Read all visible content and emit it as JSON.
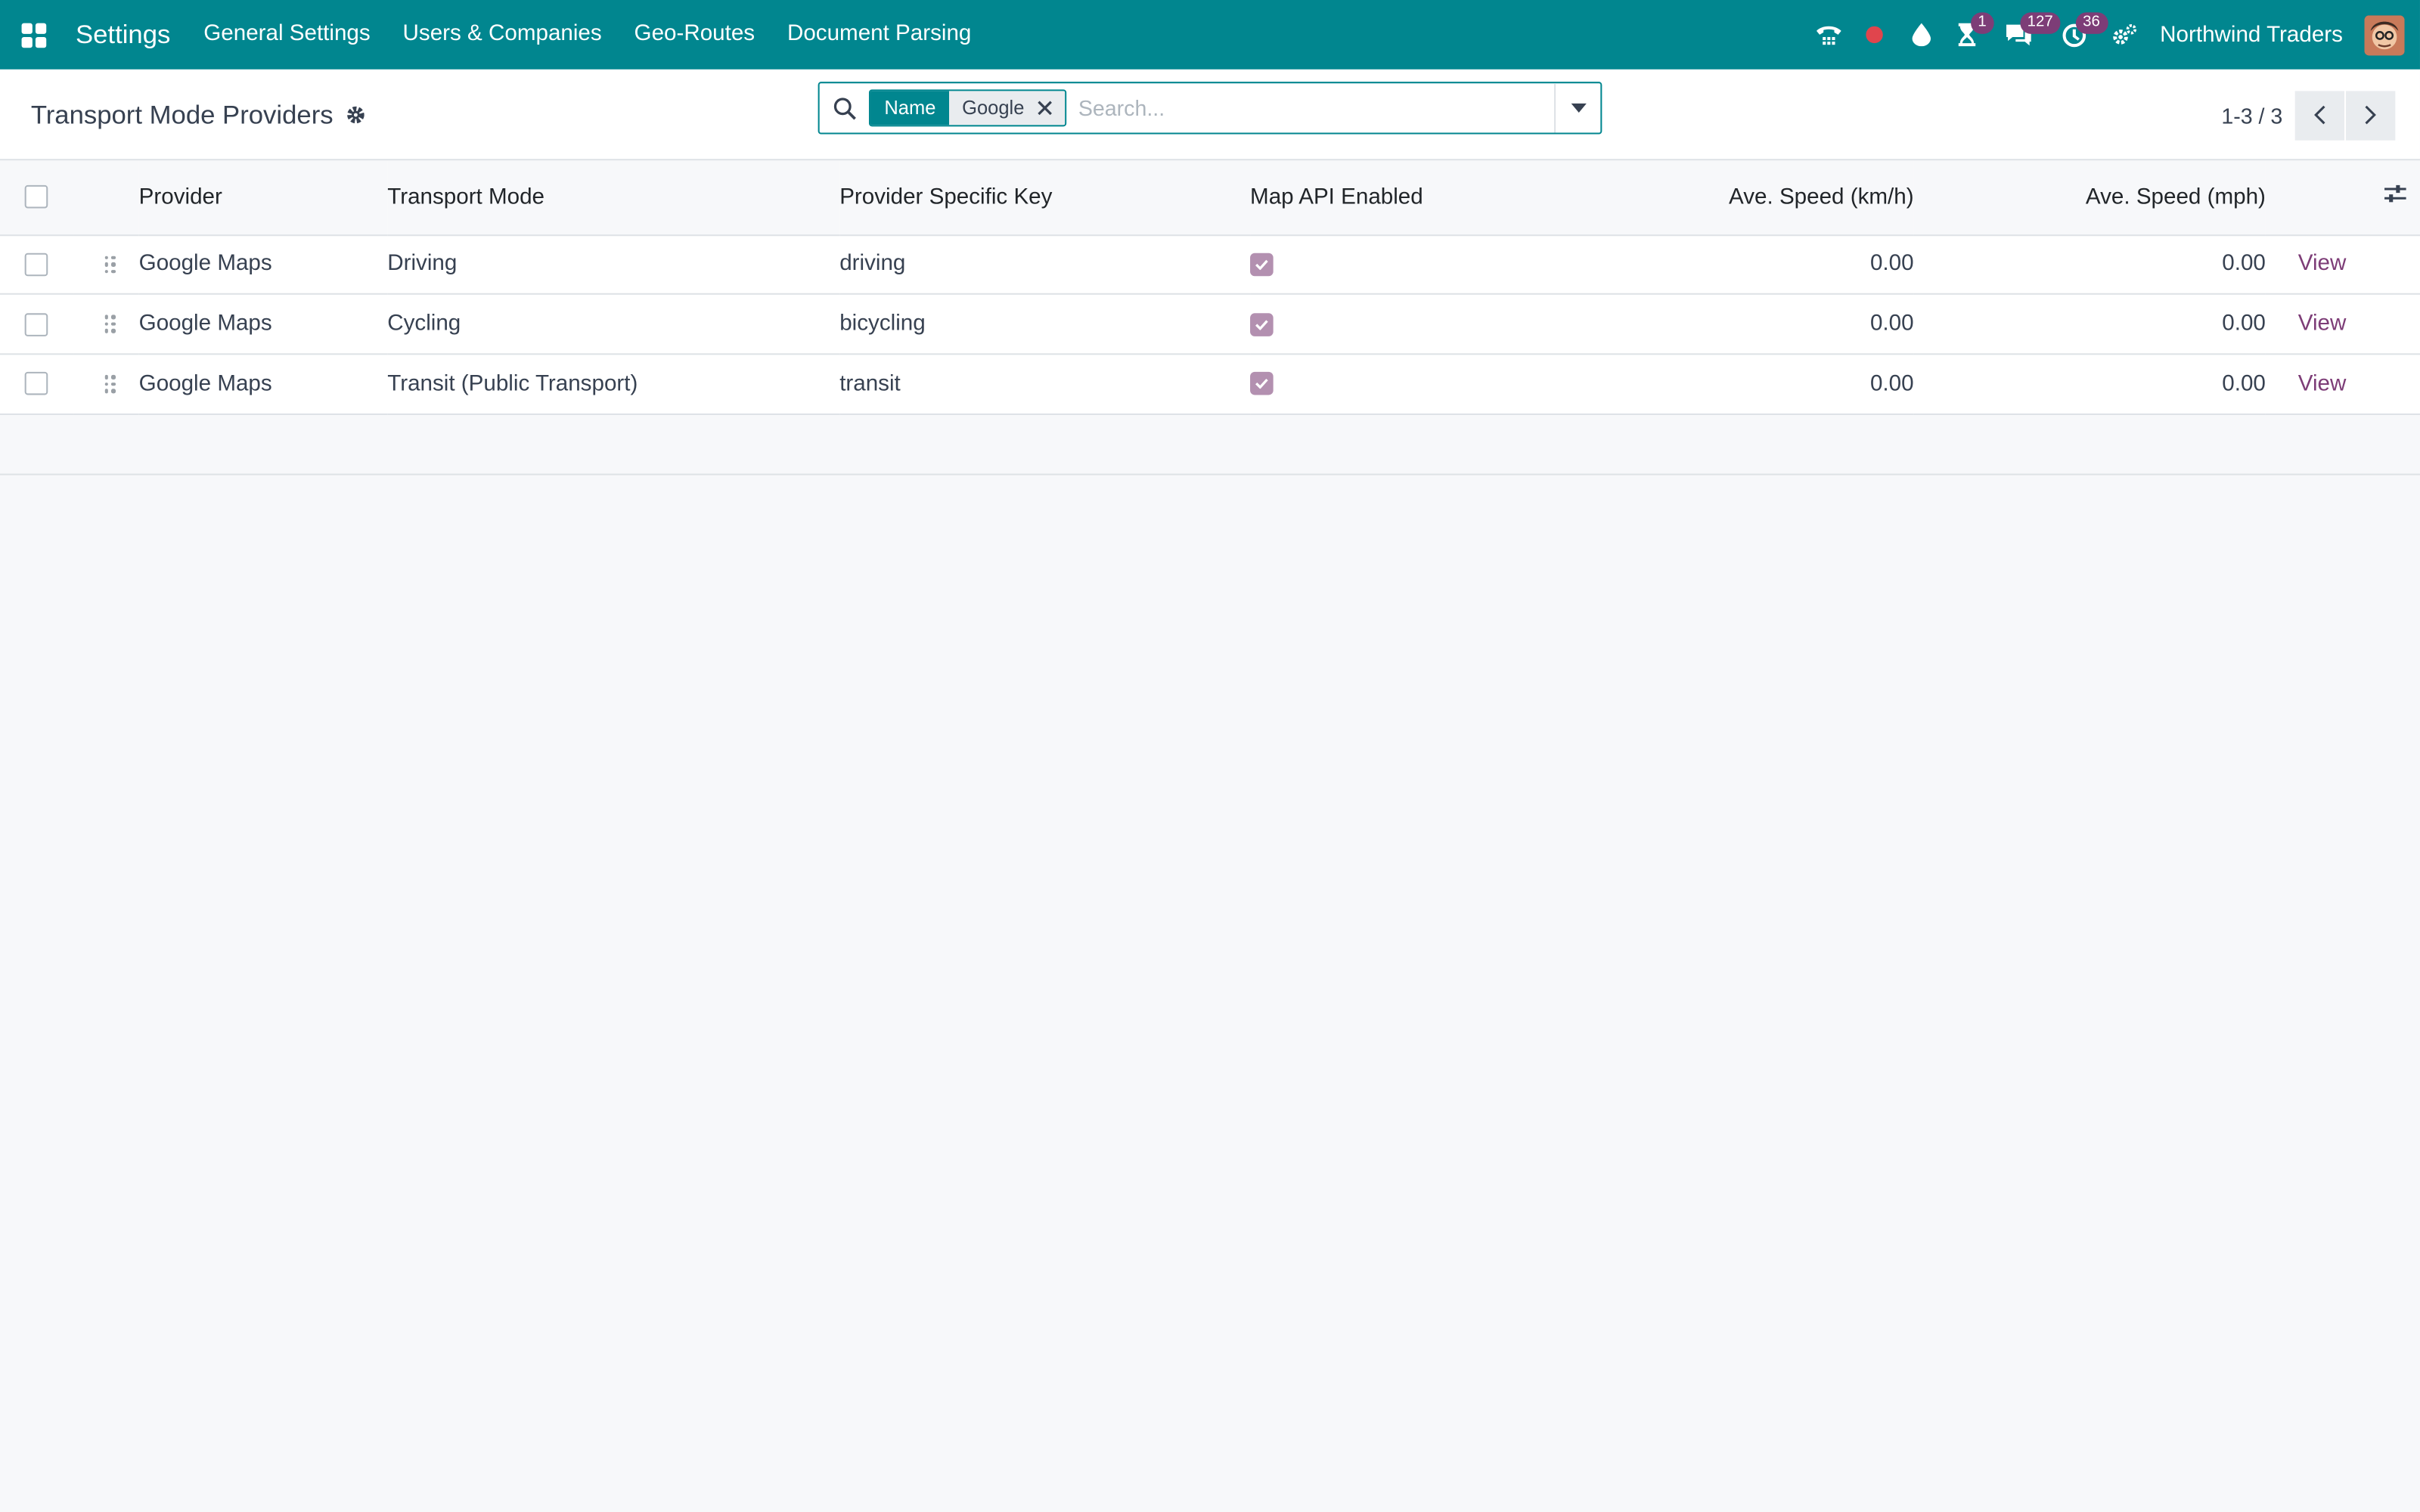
{
  "navbar": {
    "brand": "Settings",
    "menu": [
      "General Settings",
      "Users & Companies",
      "Geo-Routes",
      "Document Parsing"
    ],
    "activity_badge": "1",
    "messages_badge": "127",
    "clock_badge": "36",
    "company": "Northwind Traders"
  },
  "control_panel": {
    "title": "Transport Mode Providers",
    "search": {
      "facet_label": "Name",
      "facet_value": "Google",
      "placeholder": "Search..."
    },
    "pager": "1-3 / 3"
  },
  "table": {
    "columns": {
      "provider": "Provider",
      "transport_mode": "Transport Mode",
      "key": "Provider Specific Key",
      "map_api": "Map API Enabled",
      "speed_kmh": "Ave. Speed (km/h)",
      "speed_mph": "Ave. Speed (mph)"
    },
    "rows": [
      {
        "provider": "Google Maps",
        "mode": "Driving",
        "key": "driving",
        "map_api_enabled": true,
        "kmh": "0.00",
        "mph": "0.00",
        "action": "View"
      },
      {
        "provider": "Google Maps",
        "mode": "Cycling",
        "key": "bicycling",
        "map_api_enabled": true,
        "kmh": "0.00",
        "mph": "0.00",
        "action": "View"
      },
      {
        "provider": "Google Maps",
        "mode": "Transit (Public Transport)",
        "key": "transit",
        "map_api_enabled": true,
        "kmh": "0.00",
        "mph": "0.00",
        "action": "View"
      }
    ]
  },
  "colors": {
    "navbar": "#01868f",
    "accent": "#7d3d77",
    "checkbox_checked": "#b390b0"
  }
}
